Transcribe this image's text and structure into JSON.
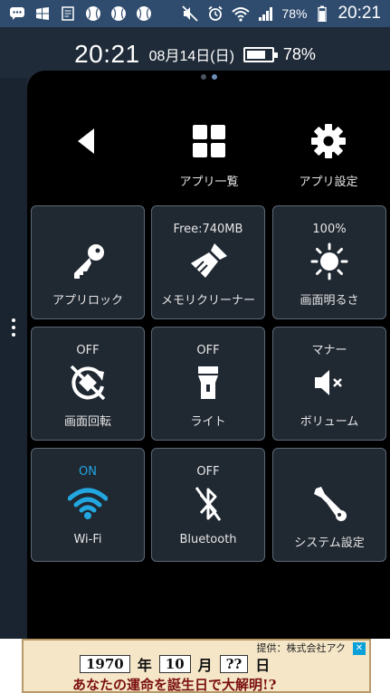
{
  "status_bar": {
    "battery_text": "78%",
    "time": "20:21"
  },
  "info_bar": {
    "time": "20:21",
    "date": "08月14日(日)",
    "battery_percent": "78%",
    "battery_level": 0.78
  },
  "pager": {
    "pages": 2,
    "active": 1
  },
  "top_buttons": [
    {
      "label": "",
      "icon": "back-arrow-icon"
    },
    {
      "label": "アプリ一覧",
      "icon": "grid-icon"
    },
    {
      "label": "アプリ設定",
      "icon": "gear-icon"
    }
  ],
  "tiles": [
    {
      "status": "",
      "label": "アプリロック",
      "icon": "key-icon"
    },
    {
      "status": "Free:740MB",
      "label": "メモリクリーナー",
      "icon": "broom-icon"
    },
    {
      "status": "100%",
      "label": "画面明るさ",
      "icon": "sun-icon"
    },
    {
      "status": "OFF",
      "label": "画面回転",
      "icon": "rotation-off-icon"
    },
    {
      "status": "OFF",
      "label": "ライト",
      "icon": "flashlight-icon"
    },
    {
      "status": "マナー",
      "label": "ボリューム",
      "icon": "volume-mute-icon"
    },
    {
      "status": "ON",
      "label": "Wi-Fi",
      "icon": "wifi-icon",
      "active_color": "#23a7e0"
    },
    {
      "status": "OFF",
      "label": "Bluetooth",
      "icon": "bluetooth-off-icon"
    },
    {
      "status": "",
      "label": "システム設定",
      "icon": "wrench-icon"
    }
  ],
  "ad": {
    "credit": "提供：株式会社アク",
    "year": "1970",
    "year_suffix": "年",
    "month": "10",
    "month_suffix": "月",
    "day": "??",
    "day_suffix": "日",
    "tagline": "あなたの運命を誕生日で大解明!?"
  },
  "colors": {
    "status_bar": "#2f4c6e",
    "panel": "#000000",
    "tile_bg": "#202832",
    "tile_border": "#5c6876",
    "accent_on": "#23a7e0"
  }
}
